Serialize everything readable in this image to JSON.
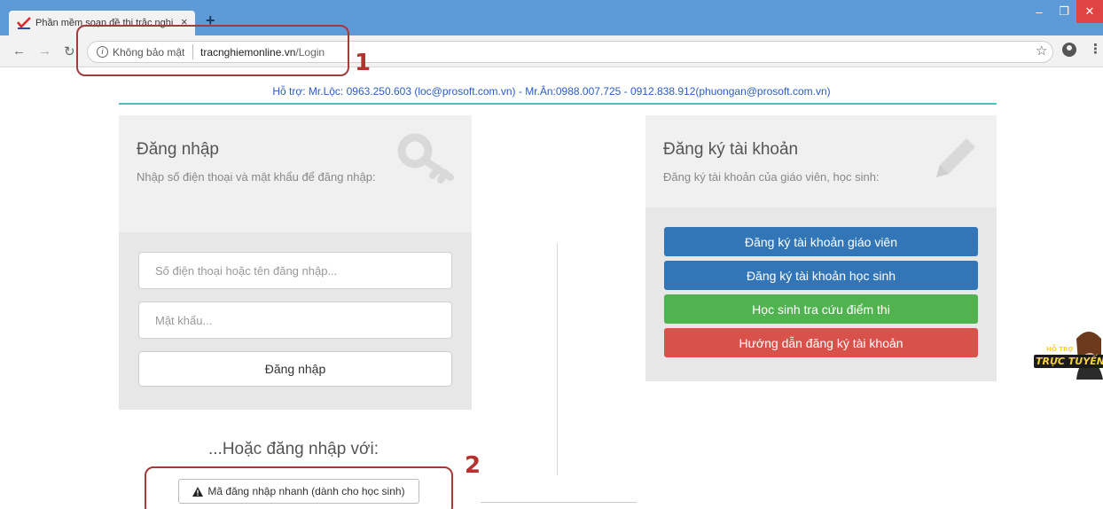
{
  "browser": {
    "tab_title": "Phần mềm soạn đề thi trắc nghi",
    "tab_close": "×",
    "new_tab": "+",
    "security": "Không bảo mật",
    "url_host": "tracnghiemonline.vn",
    "url_path": "/Login"
  },
  "annotations": {
    "one": "1",
    "two": "2"
  },
  "support_text": "Hỗ trợ: Mr.Lộc: 0963.250.603 (loc@prosoft.com.vn) - Mr.Ân:0988.007.725 - 0912.838.912(phuongan@prosoft.com.vn)",
  "login": {
    "title": "Đăng nhập",
    "description": "Nhập số điện thoại và mật khẩu để đăng nhập:",
    "username_placeholder": "Số điện thoại hoặc tên đăng nhập...",
    "password_placeholder": "Mật khẩu...",
    "button": "Đăng nhập",
    "or_text": "...Hoặc đăng nhập với:",
    "quick_login": "Mã đăng nhập nhanh (dành cho học sinh)"
  },
  "register": {
    "title": "Đăng ký tài khoản",
    "description": "Đăng ký tài khoản của giáo viên, học sinh:",
    "buttons": [
      {
        "label": "Đăng ký tài khoản giáo viên",
        "color": "#3276b8"
      },
      {
        "label": "Đăng ký tài khoản học sinh",
        "color": "#3276b8"
      },
      {
        "label": "Học sinh tra cứu điểm thi",
        "color": "#50b350"
      },
      {
        "label": "Hướng dẫn đăng ký tài khoản",
        "color": "#d8514b"
      }
    ]
  },
  "support_badge": {
    "top": "HỖ TRỢ",
    "bottom": "TRỰC TUYẾN"
  }
}
